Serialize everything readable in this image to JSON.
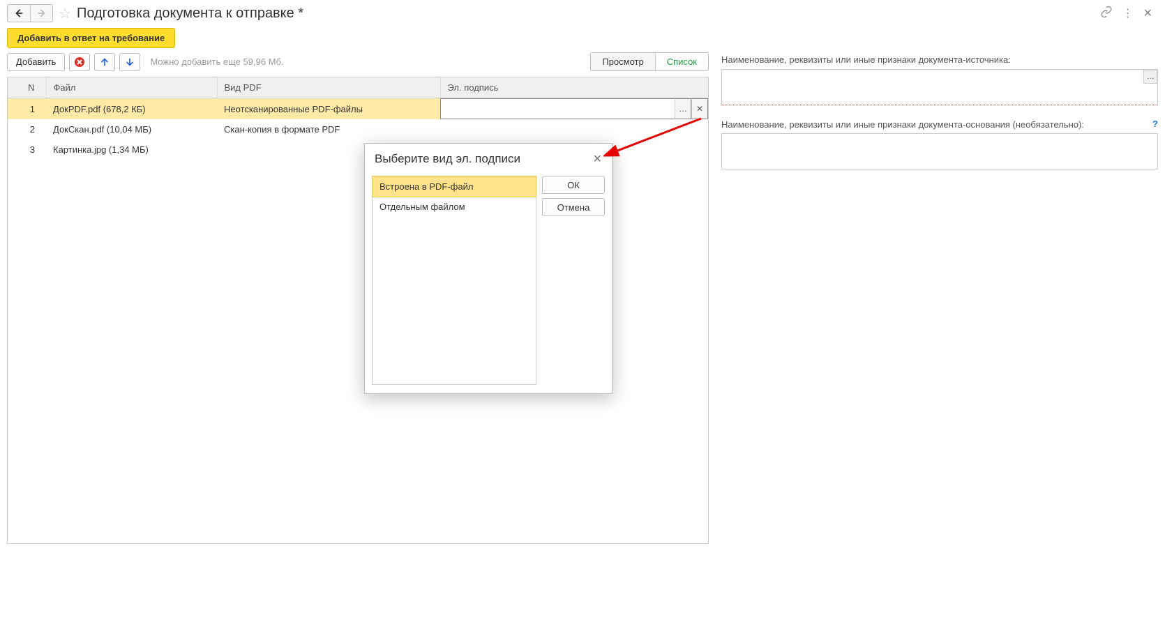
{
  "header": {
    "title": "Подготовка документа к отправке *"
  },
  "toolbar1": {
    "add_to_response": "Добавить в ответ на требование"
  },
  "toolbar2": {
    "add": "Добавить",
    "hint": "Можно добавить еще 59,96 Мб.",
    "preview": "Просмотр",
    "list": "Список"
  },
  "table": {
    "headers": {
      "n": "N",
      "file": "Файл",
      "pdf": "Вид PDF",
      "sig": "Эл. подпись"
    },
    "rows": [
      {
        "n": "1",
        "file": "ДокPDF.pdf (678,2 КБ)",
        "pdf": "Неотсканированные PDF-файлы",
        "sig": "",
        "selected": true
      },
      {
        "n": "2",
        "file": "ДокСкан.pdf (10,04 МБ)",
        "pdf": "Скан-копия в формате PDF",
        "sig": ""
      },
      {
        "n": "3",
        "file": "Картинка.jpg (1,34 МБ)",
        "pdf": "",
        "sig": ""
      }
    ]
  },
  "right": {
    "label1": "Наименование, реквизиты или иные признаки документа-источника:",
    "label2": "Наименование, реквизиты или иные признаки документа-основания (необязательно):",
    "help": "?"
  },
  "dialog": {
    "title": "Выберите вид эл. подписи",
    "ok": "ОК",
    "cancel": "Отмена",
    "options": [
      {
        "label": "Встроена в PDF-файл",
        "selected": true
      },
      {
        "label": "Отдельным файлом"
      }
    ]
  }
}
